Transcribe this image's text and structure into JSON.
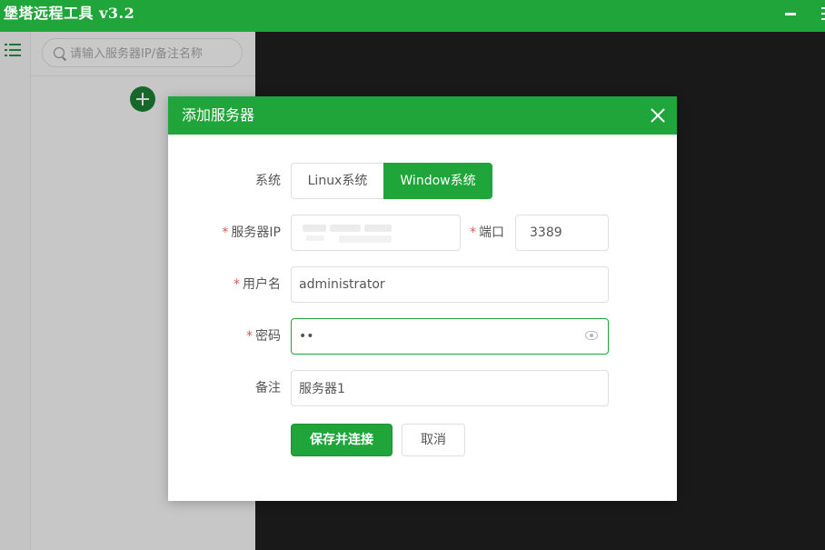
{
  "app": {
    "title": "堡塔远程工具 v3.2"
  },
  "sidebar": {
    "search_placeholder": "请输入服务器IP/备注名称"
  },
  "dialog": {
    "title": "添加服务器",
    "system": {
      "label": "系统",
      "options": [
        "Linux系统",
        "Window系统"
      ],
      "selected": "Window系统"
    },
    "ip": {
      "label": "服务器IP",
      "value": ""
    },
    "port": {
      "label": "端口",
      "value": "3389"
    },
    "username": {
      "label": "用户名",
      "value": "administrator"
    },
    "password": {
      "label": "密码",
      "value": "••"
    },
    "note": {
      "label": "备注",
      "value": "服务器1"
    },
    "required_mark": "*",
    "save_label": "保存并连接",
    "cancel_label": "取消"
  },
  "colors": {
    "brand": "#20a53a",
    "required": "#e05555"
  }
}
